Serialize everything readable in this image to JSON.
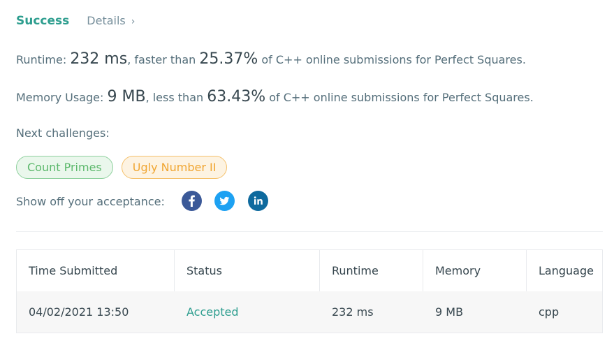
{
  "header": {
    "status_label": "Success",
    "details_label": "Details",
    "details_chevron": "›"
  },
  "runtime": {
    "prefix": "Runtime: ",
    "value": "232 ms",
    "middle": ", faster than ",
    "percent": "25.37%",
    "suffix": " of C++ online submissions for Perfect Squares."
  },
  "memory": {
    "prefix": "Memory Usage: ",
    "value": "9 MB",
    "middle": ", less than ",
    "percent": "63.43%",
    "suffix": " of C++ online submissions for Perfect Squares."
  },
  "next_challenges": {
    "label": "Next challenges:",
    "items": [
      {
        "label": "Count Primes",
        "difficulty": "easy",
        "color": "#5cb86c"
      },
      {
        "label": "Ugly Number II",
        "difficulty": "medium",
        "color": "#f0a531"
      }
    ]
  },
  "share": {
    "label": "Show off your acceptance:",
    "icons": [
      "facebook-icon",
      "twitter-icon",
      "linkedin-icon"
    ]
  },
  "table": {
    "headers": [
      "Time Submitted",
      "Status",
      "Runtime",
      "Memory",
      "Language"
    ],
    "rows": [
      [
        "04/02/2021 13:50",
        "Accepted",
        "232 ms",
        "9 MB",
        "cpp"
      ]
    ]
  },
  "colors": {
    "accent": "#2e9e8f",
    "facebook": "#3b5998",
    "twitter": "#1da1f2",
    "linkedin": "#0e6a9e"
  }
}
